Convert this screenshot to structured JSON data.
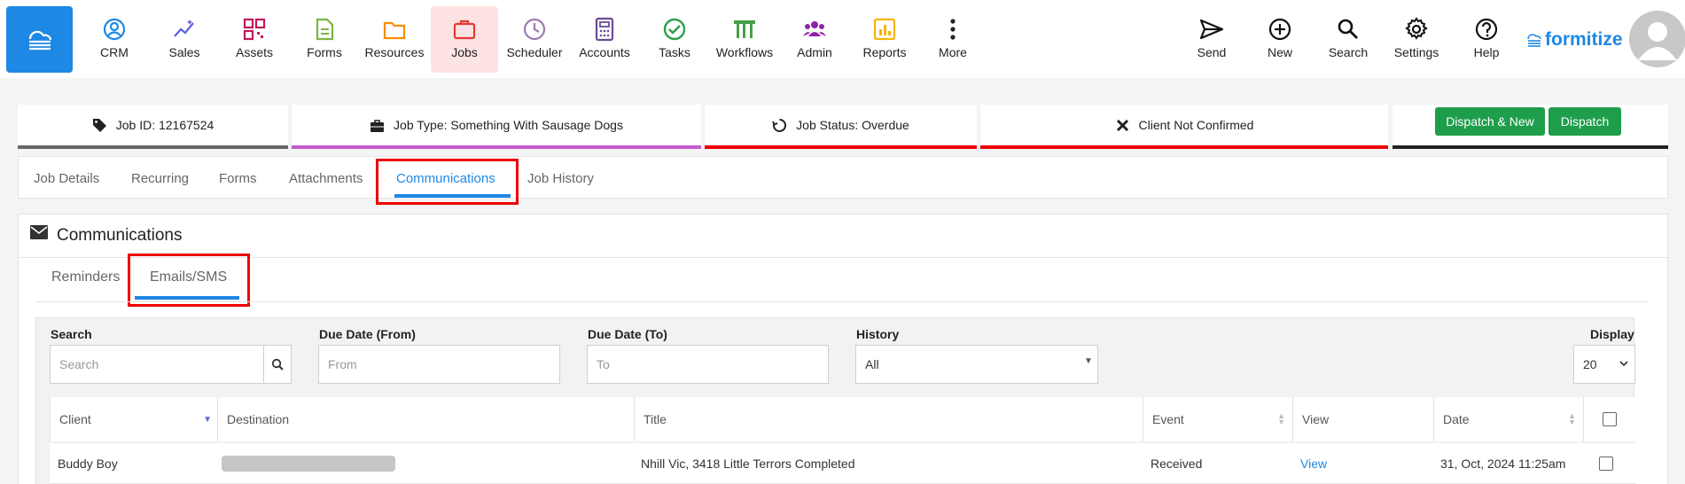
{
  "topnav": {
    "items": [
      {
        "label": "CRM",
        "icon": "crm-icon",
        "color": "#1e88e5"
      },
      {
        "label": "Sales",
        "icon": "sales-icon",
        "color": "#5b5fe0"
      },
      {
        "label": "Assets",
        "icon": "assets-icon",
        "color": "#c2185b"
      },
      {
        "label": "Forms",
        "icon": "forms-icon",
        "color": "#7cb342"
      },
      {
        "label": "Resources",
        "icon": "resources-icon",
        "color": "#fb8c00"
      },
      {
        "label": "Jobs",
        "icon": "jobs-icon",
        "color": "#e53935"
      },
      {
        "label": "Scheduler",
        "icon": "scheduler-icon",
        "color": "#9c7ab0"
      },
      {
        "label": "Accounts",
        "icon": "accounts-icon",
        "color": "#6a4c93"
      },
      {
        "label": "Tasks",
        "icon": "tasks-icon",
        "color": "#2e9e4a"
      },
      {
        "label": "Workflows",
        "icon": "workflows-icon",
        "color": "#43a047"
      },
      {
        "label": "Admin",
        "icon": "admin-icon",
        "color": "#8e24aa"
      },
      {
        "label": "Reports",
        "icon": "reports-icon",
        "color": "#f6b400"
      },
      {
        "label": "More",
        "icon": "more-icon",
        "color": "#222222"
      }
    ],
    "active": "Jobs",
    "right_items": [
      {
        "label": "Send",
        "icon": "send-icon"
      },
      {
        "label": "New",
        "icon": "plus-circle-icon"
      },
      {
        "label": "Search",
        "icon": "search-icon"
      },
      {
        "label": "Settings",
        "icon": "gear-icon"
      },
      {
        "label": "Help",
        "icon": "help-icon"
      }
    ],
    "brand": "formitize"
  },
  "status": {
    "job_id": "Job ID: 12167524",
    "job_type": "Job Type: Something With Sausage Dogs",
    "job_status": "Job Status: Overdue",
    "client": "Client Not Confirmed",
    "dispatch_new_label": "Dispatch & New",
    "dispatch_label": "Dispatch",
    "colors": {
      "job_id": "#666666",
      "job_type": "#c35bd0",
      "job_status": "#ee0000",
      "client": "#ee0000",
      "dispatch": "#222222"
    }
  },
  "tabs": [
    "Job Details",
    "Recurring",
    "Forms",
    "Attachments",
    "Communications",
    "Job History"
  ],
  "active_tab": "Communications",
  "panel": {
    "title": "Communications",
    "subtabs": [
      "Reminders",
      "Emails/SMS"
    ],
    "active_subtab": "Emails/SMS"
  },
  "filters": {
    "search_label": "Search",
    "search_placeholder": "Search",
    "due_from_label": "Due Date (From)",
    "due_from_placeholder": "From",
    "due_to_label": "Due Date (To)",
    "due_to_placeholder": "To",
    "history_label": "History",
    "history_value": "All",
    "display_label": "Display",
    "display_value": "20"
  },
  "table": {
    "columns": [
      "Client",
      "Destination",
      "Title",
      "Event",
      "View",
      "Date"
    ],
    "rows": [
      {
        "client": "Buddy Boy",
        "destination": "",
        "title": "Nhill Vic, 3418 Little Terrors Completed",
        "event": "Received",
        "view": "View",
        "date": "31, Oct, 2024 11:25am"
      }
    ]
  }
}
